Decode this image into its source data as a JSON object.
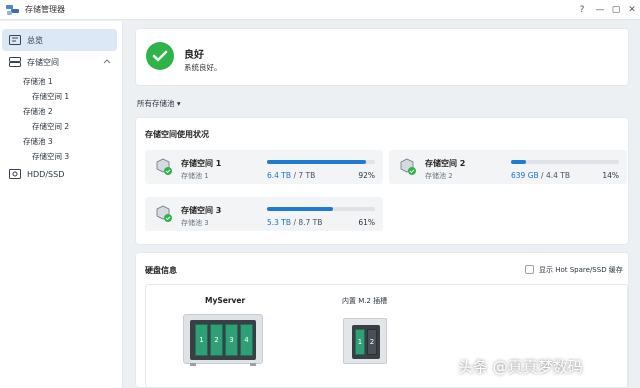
{
  "window": {
    "title": "存储管理器",
    "help_label": "?",
    "minimize_label": "—",
    "maximize_label": "▢",
    "close_label": "✕"
  },
  "sidebar": {
    "items": [
      {
        "label": "总览",
        "icon": "overview-icon",
        "active": true
      },
      {
        "label": "存储空间",
        "icon": "storage-icon",
        "expanded": true
      },
      {
        "label": "HDD/SSD",
        "icon": "disk-icon"
      }
    ],
    "tree": [
      {
        "label": "存储池 1"
      },
      {
        "label": "存储空间 1"
      },
      {
        "label": "存储池 2"
      },
      {
        "label": "存储空间 2"
      },
      {
        "label": "存储池 3"
      },
      {
        "label": "存储空间 3"
      }
    ],
    "collapse_icon": "chevron-up-icon"
  },
  "status": {
    "title": "良好",
    "description": "系统良好。",
    "icon": "check-circle-icon",
    "color": "#2fb44a"
  },
  "pool_filter": {
    "label": "所有存储池",
    "caret": "▾"
  },
  "usage": {
    "title": "存储空间使用状况",
    "volumes": [
      {
        "name": "存储空间 1",
        "pool": "存储池 1",
        "used": "6.4 TB",
        "total": "/ 7 TB",
        "percent": "92%",
        "fraction": 0.92
      },
      {
        "name": "存储空间 2",
        "pool": "存储池 2",
        "used": "639 GB",
        "total": "/ 4.4 TB",
        "percent": "14%",
        "fraction": 0.14
      },
      {
        "name": "存储空间 3",
        "pool": "存储池 3",
        "used": "5.3 TB",
        "total": "/ 8.7 TB",
        "percent": "61%",
        "fraction": 0.61
      }
    ],
    "bar_color": "#1f7ad3"
  },
  "disk_info": {
    "title": "硬盘信息",
    "hot_spare_label": "显示 Hot Spare/SSD 缓存",
    "server_name": "MyServer",
    "bays": [
      "1",
      "2",
      "3",
      "4"
    ],
    "m2_label": "内置 M.2 插槽",
    "m2_slots": [
      "1",
      "2"
    ]
  },
  "watermark": "头条 @真真梦数码"
}
